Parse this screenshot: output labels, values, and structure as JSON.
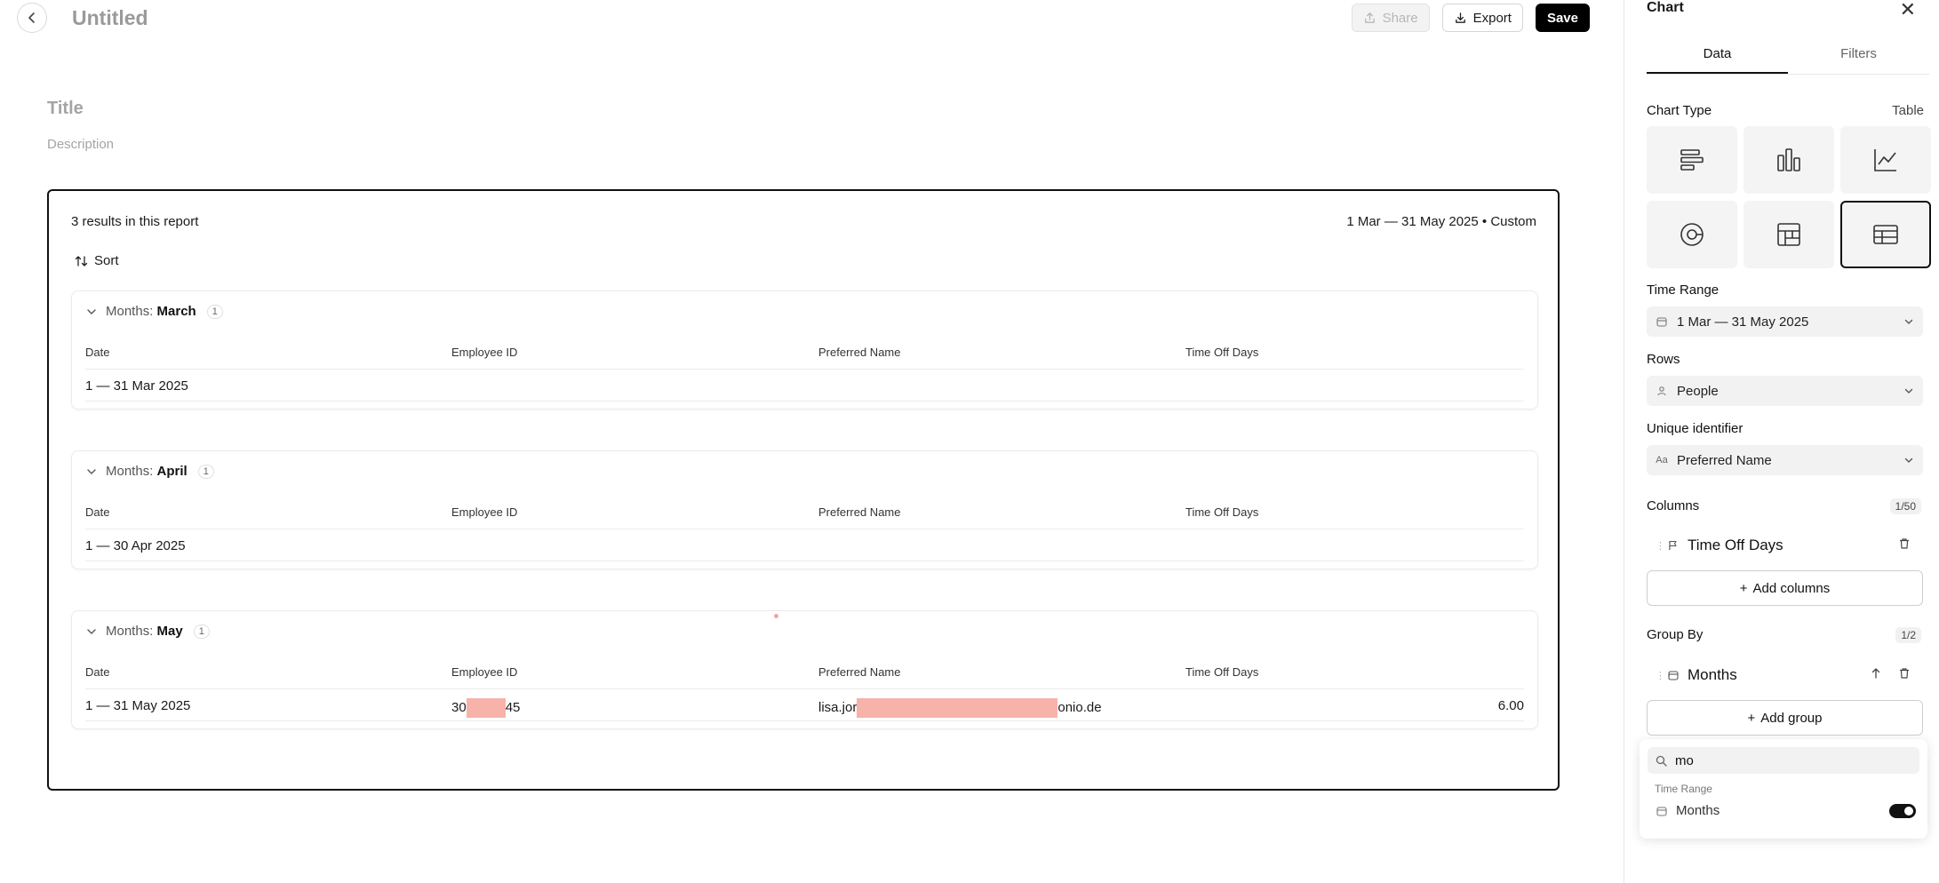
{
  "header": {
    "title": "Untitled",
    "share_label": "Share",
    "export_label": "Export",
    "save_label": "Save"
  },
  "report": {
    "title_placeholder": "Title",
    "description_placeholder": "Description",
    "results_count": "3 results in this report",
    "date_range": "1 Mar — 31 May 2025 • Custom",
    "sort_label": "Sort",
    "columns": [
      "Date",
      "Employee ID",
      "Preferred Name",
      "Time Off Days"
    ],
    "groups": [
      {
        "prefix": "Months:",
        "name": "March",
        "count": "1",
        "row": {
          "date": "1 — 31 Mar 2025",
          "employee_id": "",
          "preferred_name": "",
          "time_off_days": ""
        }
      },
      {
        "prefix": "Months:",
        "name": "April",
        "count": "1",
        "row": {
          "date": "1 — 30 Apr 2025",
          "employee_id": "",
          "preferred_name": "",
          "time_off_days": ""
        }
      },
      {
        "prefix": "Months:",
        "name": "May",
        "count": "1",
        "row": {
          "date": "1 — 31 May 2025",
          "employee_id_start": "30",
          "employee_id_end": "45",
          "preferred_name_start": "lisa.jor",
          "preferred_name_end": "onio.de",
          "time_off_days": "6.00"
        }
      }
    ]
  },
  "panel": {
    "title": "Chart",
    "close_glyph": "✕",
    "tabs": [
      "Data",
      "Filters"
    ],
    "chart_type_label": "Chart Type",
    "chart_type_value": "Table",
    "chart_types": [
      "bar-horizontal-icon",
      "bar-vertical-icon",
      "line-chart-icon",
      "donut-chart-icon",
      "pivot-icon",
      "table-icon"
    ],
    "time_range_label": "Time Range",
    "time_range_value": "1 Mar — 31 May 2025",
    "rows_label": "Rows",
    "rows_value": "People",
    "unique_identifier_label": "Unique identifier",
    "unique_identifier_value": "Preferred Name",
    "unique_identifier_icon": "Aa",
    "columns_label": "Columns",
    "columns_count": "1/50",
    "column_item": "Time Off Days",
    "add_columns_label": "Add columns",
    "group_by_label": "Group By",
    "group_by_count": "1/2",
    "group_item": "Months",
    "add_group_label": "Add group"
  },
  "dropdown": {
    "search_value": "mo",
    "group_label": "Time Range",
    "item_label": "Months",
    "item_enabled": true
  }
}
